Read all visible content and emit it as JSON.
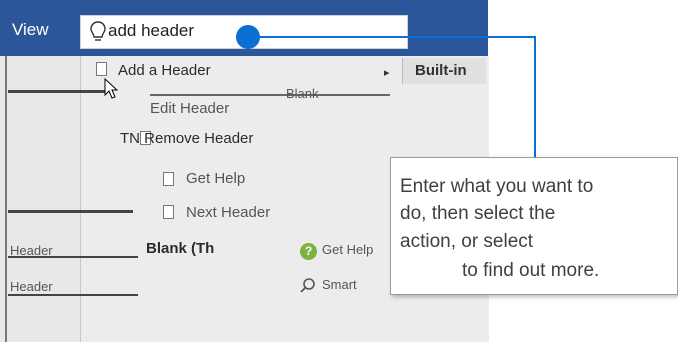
{
  "ribbon": {
    "tab_label": "View",
    "tellme_value": "add header"
  },
  "menu": {
    "items": [
      {
        "label": "Add a Header",
        "icon": "page-icon"
      },
      {
        "label": "Edit Header",
        "icon": "page-icon"
      },
      {
        "label": "TN  Remove Header",
        "icon": "page-icon"
      },
      {
        "label": "Get Help",
        "icon": "page-icon"
      },
      {
        "label": "Next Header",
        "icon": "page-icon"
      }
    ],
    "gallery_header": "Built-in",
    "gallery_item": "Blank",
    "sub_item": "Blank (Th",
    "left_items": [
      "Header",
      "Header"
    ],
    "help_label": "Get Help",
    "smart_label": "Smart",
    "caret": "▸"
  },
  "tooltip": {
    "lines": [
      "Enter what you want to",
      "do, then select the",
      "action, or select",
      "to find out more."
    ]
  },
  "colors": {
    "ribbon": "#2b579a",
    "accent": "#0a6fd1"
  }
}
